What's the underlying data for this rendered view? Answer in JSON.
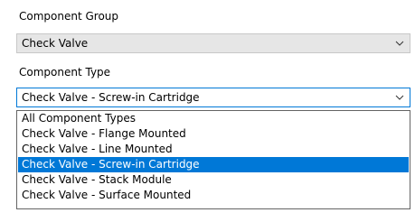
{
  "component_group": {
    "label": "Component Group",
    "value": "Check Valve",
    "chevron_icon": "chevron-down-icon"
  },
  "component_type": {
    "label": "Component Type",
    "value": "Check Valve - Screw-in Cartridge",
    "chevron_icon": "chevron-down-icon",
    "options": [
      "All Component Types",
      "Check Valve - Flange Mounted",
      "Check Valve - Line Mounted",
      "Check Valve - Screw-in Cartridge",
      "Check Valve - Stack Module",
      "Check Valve - Surface Mounted"
    ],
    "selected_index": 3
  },
  "colors": {
    "selection": "#0078d7",
    "combo_background": "#e6e6e6",
    "focus_border": "#0078d7"
  }
}
